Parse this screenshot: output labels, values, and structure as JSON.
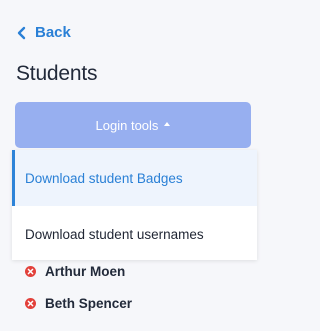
{
  "nav": {
    "back_label": "Back"
  },
  "page": {
    "title": "Students"
  },
  "login_tools": {
    "label": "Login tools"
  },
  "dropdown": {
    "items": [
      {
        "label": "Download student Badges"
      },
      {
        "label": "Download student usernames"
      }
    ]
  },
  "students": [
    {
      "name": "Arthur Moen",
      "status_icon": "remove-icon"
    },
    {
      "name": "Beth Spencer",
      "status_icon": "remove-icon"
    }
  ],
  "colors": {
    "accent": "#2a80d6",
    "button_bg": "#97aff0",
    "remove_red": "#e2403a"
  }
}
